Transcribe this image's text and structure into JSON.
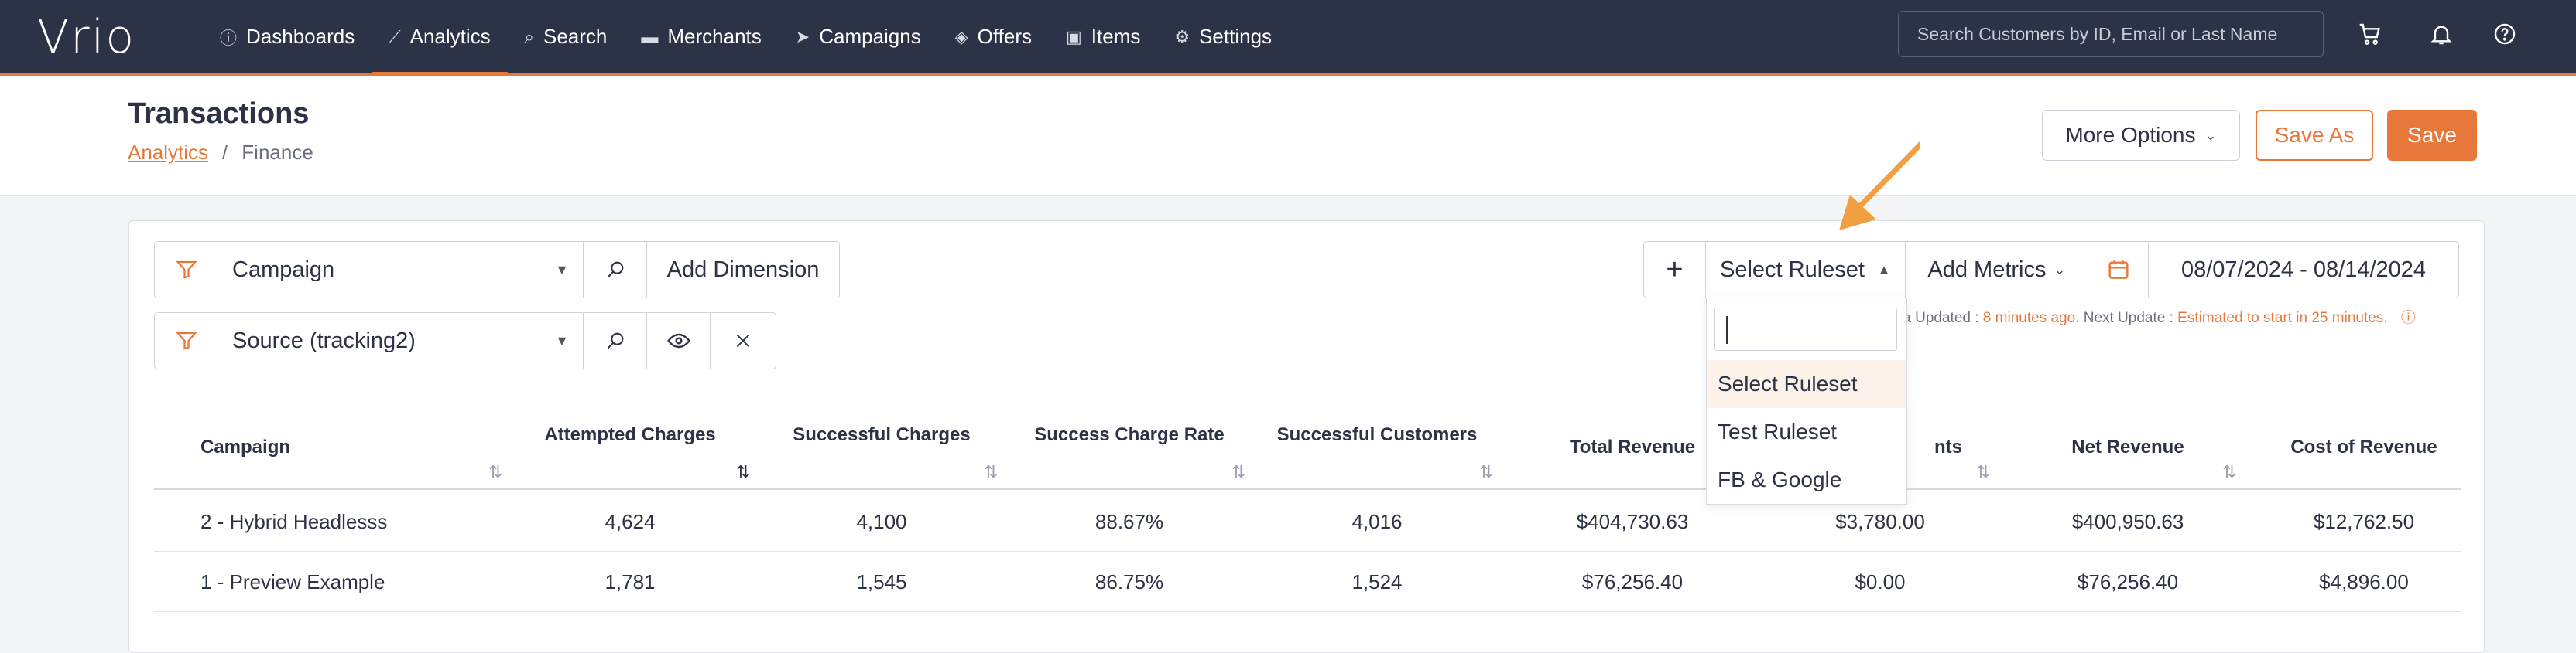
{
  "app": {
    "logo": "Vrio"
  },
  "nav": [
    {
      "label": "Dashboards",
      "icon": "info-circle-icon",
      "glyph": "ⓘ"
    },
    {
      "label": "Analytics",
      "icon": "chart-icon",
      "glyph": "📈"
    },
    {
      "label": "Search",
      "icon": "search-icon",
      "glyph": "⌕"
    },
    {
      "label": "Merchants",
      "icon": "card-icon",
      "glyph": "▬"
    },
    {
      "label": "Campaigns",
      "icon": "send-icon",
      "glyph": "➤"
    },
    {
      "label": "Offers",
      "icon": "layers-icon",
      "glyph": "◈"
    },
    {
      "label": "Items",
      "icon": "box-icon",
      "glyph": "▣"
    },
    {
      "label": "Settings",
      "icon": "gears-icon",
      "glyph": "⚙"
    }
  ],
  "active_nav": "Analytics",
  "search": {
    "placeholder": "Search Customers by ID, Email or Last Name"
  },
  "page": {
    "title": "Transactions",
    "breadcrumb_link": "Analytics",
    "breadcrumb_sep": "/",
    "breadcrumb_current": "Finance"
  },
  "actions": {
    "more": "More Options",
    "save_as": "Save As",
    "save": "Save"
  },
  "filters": {
    "row1_dimension": "Campaign",
    "add_dimension": "Add Dimension",
    "row2_dimension": "Source (tracking2)"
  },
  "toolbar": {
    "plus": "+",
    "ruleset": "Select Ruleset",
    "add_metrics": "Add Metrics",
    "date_range": "08/07/2024 - 08/14/2024"
  },
  "update_info": {
    "label1": "ta Updated : ",
    "value1": "8 minutes ago.",
    "label2": " Next Update : ",
    "value2": "Estimated to start in 25 minutes."
  },
  "ruleset_dropdown": {
    "search_value": "",
    "options": [
      "Select Ruleset",
      "Test Ruleset",
      "FB & Google"
    ],
    "selected": "Select Ruleset"
  },
  "table": {
    "columns": [
      "Campaign",
      "Attempted Charges",
      "Successful Charges",
      "Success Charge Rate",
      "Successful Customers",
      "Total Revenue",
      "nts",
      "Net Revenue",
      "Cost of Revenue"
    ],
    "rows": [
      [
        "2 - Hybrid Headlesss",
        "4,624",
        "4,100",
        "88.67%",
        "4,016",
        "$404,730.63",
        "$3,780.00",
        "$400,950.63",
        "$12,762.50"
      ],
      [
        "1 - Preview Example",
        "1,781",
        "1,545",
        "86.75%",
        "1,524",
        "$76,256.40",
        "$0.00",
        "$76,256.40",
        "$4,896.00"
      ]
    ]
  },
  "colors": {
    "nav_bg": "#2d3346",
    "accent": "#e8773a"
  }
}
